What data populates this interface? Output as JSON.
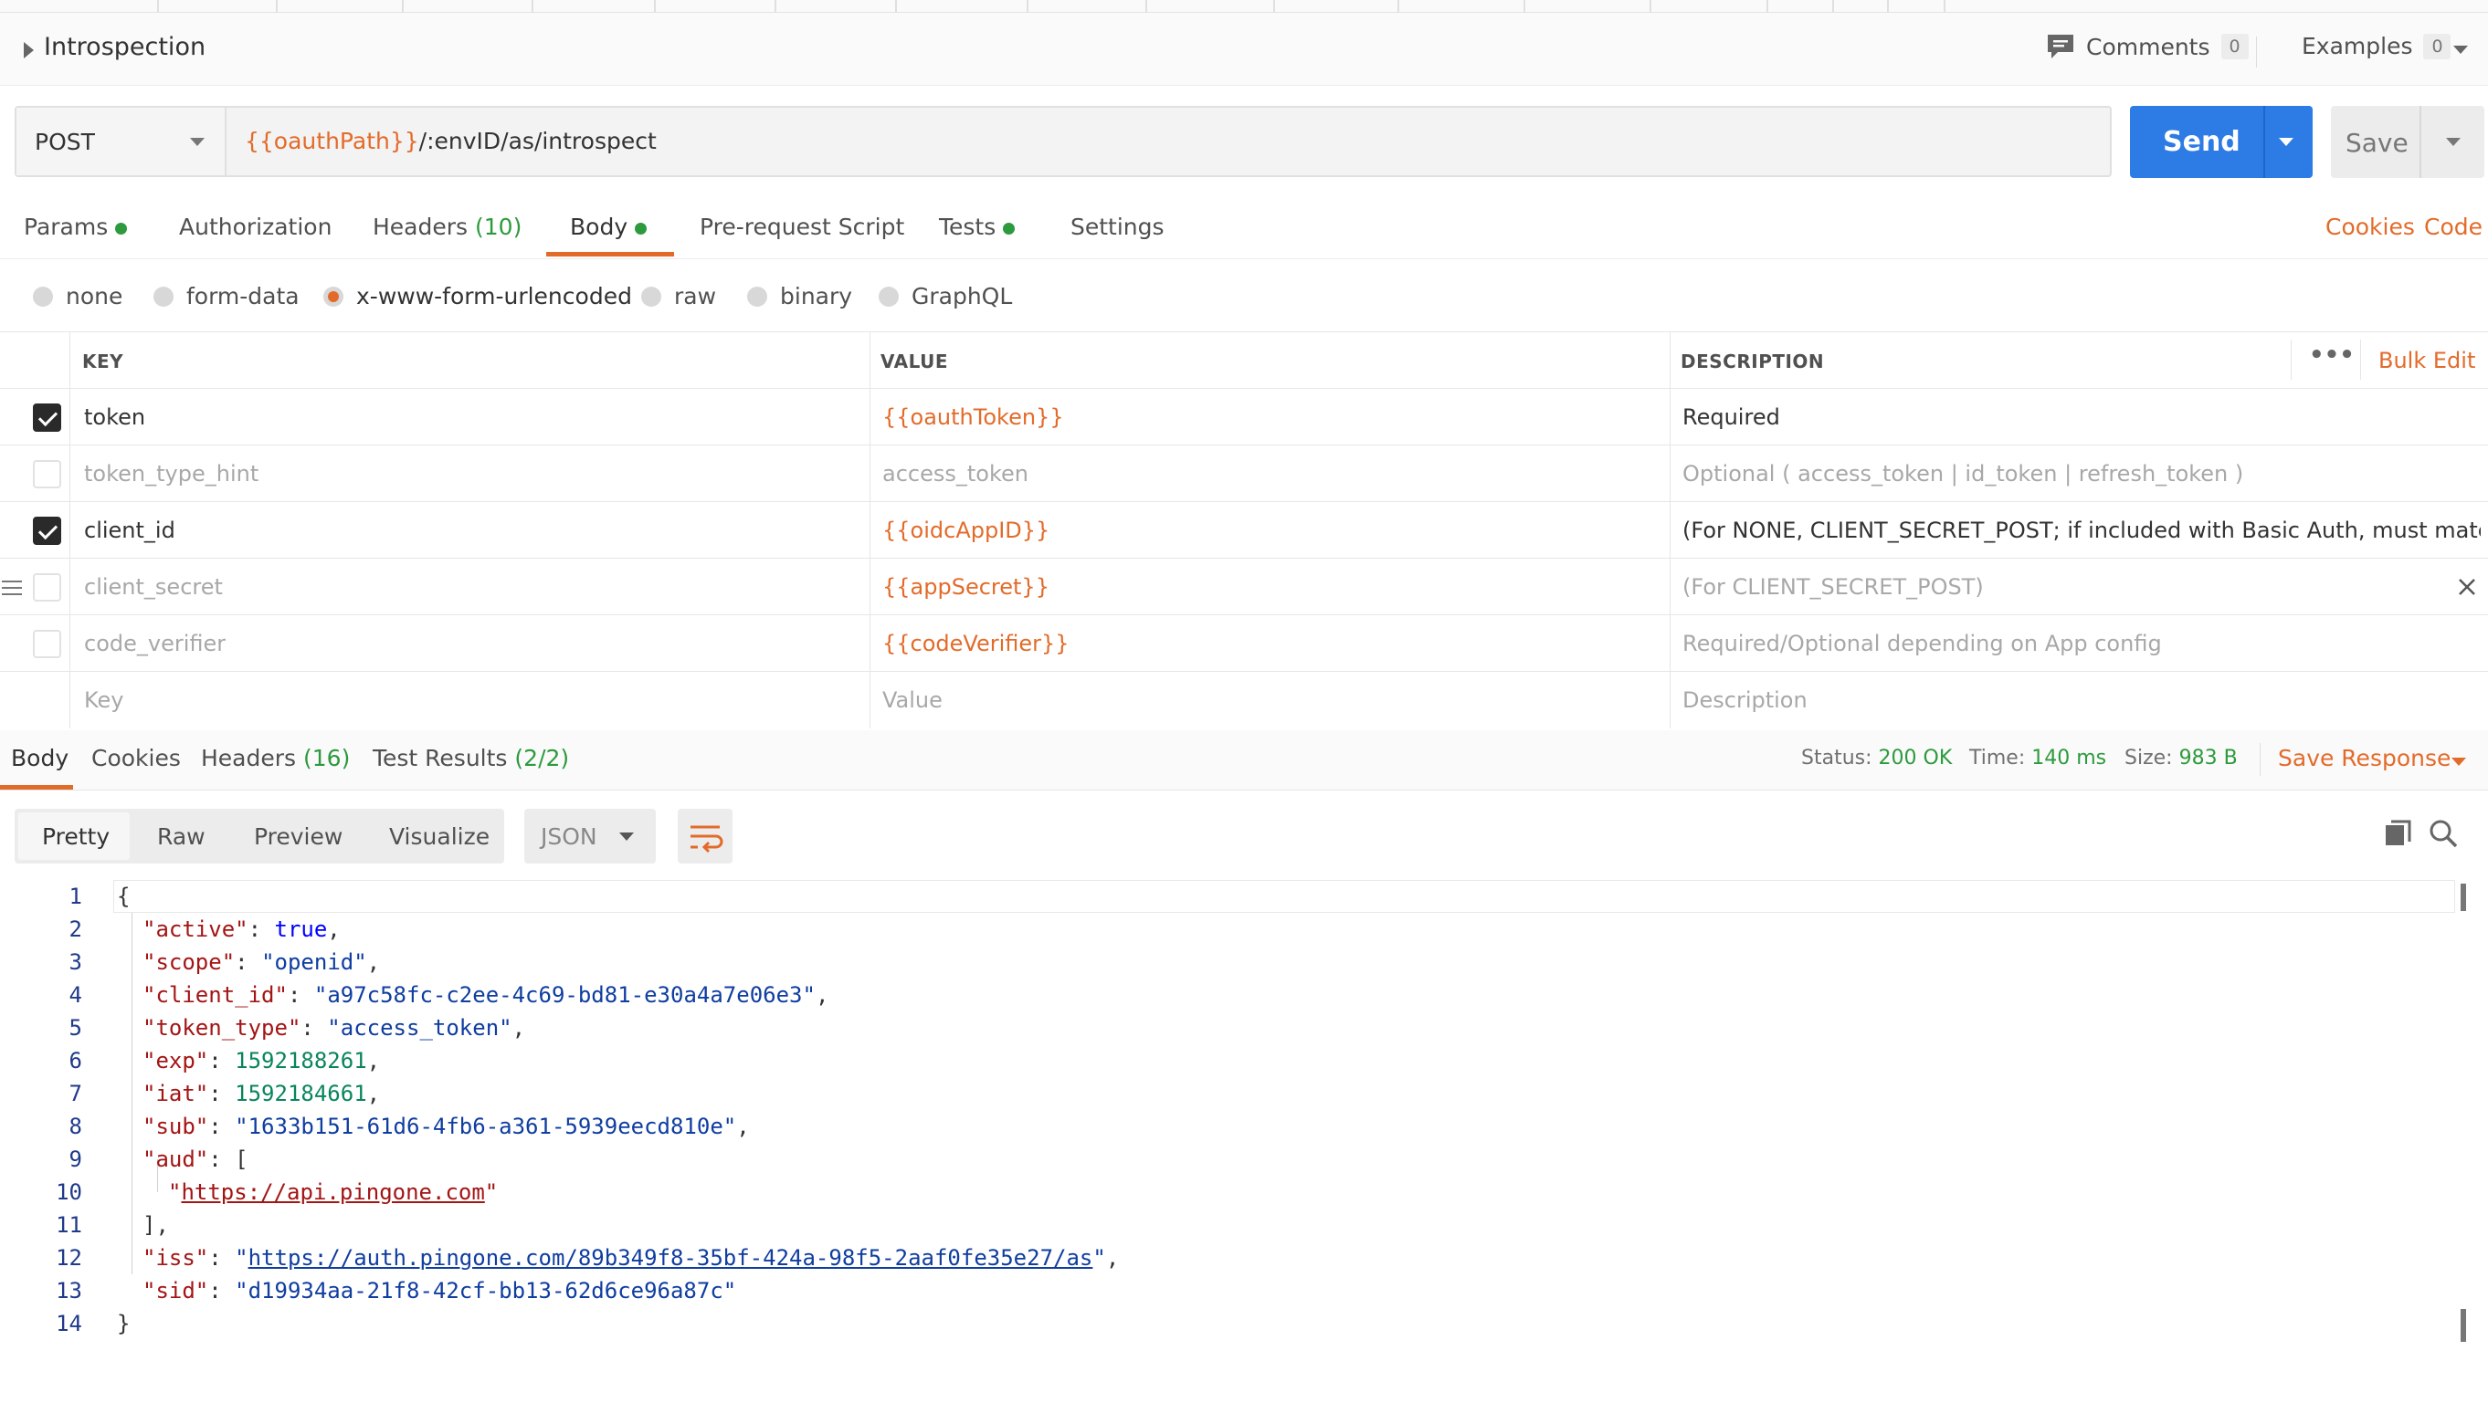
{
  "request": {
    "title": "Introspection",
    "comments_label": "Comments",
    "comments_count": "0",
    "examples_label": "Examples",
    "examples_count": "0",
    "method": "POST",
    "url_var": "{{oauthPath}}",
    "url_rest": "/:envID/as/introspect",
    "send_label": "Send",
    "save_label": "Save"
  },
  "tabs": {
    "params": "Params",
    "authorization": "Authorization",
    "headers": "Headers",
    "headers_count": "(10)",
    "body": "Body",
    "prerequest": "Pre-request Script",
    "tests": "Tests",
    "settings": "Settings",
    "cookies": "Cookies",
    "code": "Code"
  },
  "body_types": [
    "none",
    "form-data",
    "x-www-form-urlencoded",
    "raw",
    "binary",
    "GraphQL"
  ],
  "body_type_selected": "x-www-form-urlencoded",
  "table": {
    "headers": {
      "key": "KEY",
      "value": "VALUE",
      "description": "DESCRIPTION"
    },
    "bulk_edit": "Bulk Edit",
    "more_icon": "•••",
    "rows": [
      {
        "checked": true,
        "key": "token",
        "value": "{{oauthToken}}",
        "description": "Required"
      },
      {
        "checked": false,
        "key": "token_type_hint",
        "value": "access_token",
        "description": "Optional ( access_token | id_token | refresh_token )"
      },
      {
        "checked": true,
        "key": "client_id",
        "value": "{{oidcAppID}}",
        "description": "(For NONE, CLIENT_SECRET_POST; if included with Basic Auth, must match H ..."
      },
      {
        "checked": false,
        "key": "client_secret",
        "value": "{{appSecret}}",
        "description": "(For CLIENT_SECRET_POST)"
      },
      {
        "checked": false,
        "key": "code_verifier",
        "value": "{{codeVerifier}}",
        "description": "Required/Optional depending on App config"
      }
    ],
    "placeholder": {
      "key": "Key",
      "value": "Value",
      "description": "Description"
    }
  },
  "response": {
    "tabs": {
      "body": "Body",
      "cookies": "Cookies",
      "headers": "Headers",
      "headers_count": "(16)",
      "test_results": "Test Results",
      "test_results_count": "(2/2)"
    },
    "status_label": "Status:",
    "status_value": "200 OK",
    "time_label": "Time:",
    "time_value": "140 ms",
    "size_label": "Size:",
    "size_value": "983 B",
    "save_response": "Save Response",
    "views": [
      "Pretty",
      "Raw",
      "Preview",
      "Visualize"
    ],
    "format": "JSON",
    "json": {
      "active": "true",
      "scope": "openid",
      "client_id": "a97c58fc-c2ee-4c69-bd81-e30a4a7e06e3",
      "token_type": "access_token",
      "exp": "1592188261",
      "iat": "1592184661",
      "sub": "1633b151-61d6-4fb6-a361-5939eecd810e",
      "aud_0": "https://api.pingone.com",
      "iss": "https://auth.pingone.com/89b349f8-35bf-424a-98f5-2aaf0fe35e27/as",
      "sid": "d19934aa-21f8-42cf-bb13-62d6ce96a87c"
    },
    "line_numbers": [
      "1",
      "2",
      "3",
      "4",
      "5",
      "6",
      "7",
      "8",
      "9",
      "10",
      "11",
      "12",
      "13",
      "14"
    ]
  }
}
